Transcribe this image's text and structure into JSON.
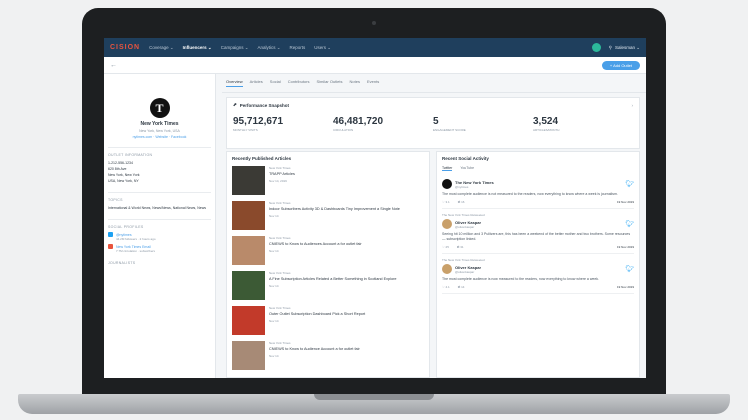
{
  "nav": {
    "logo_main": "CISION",
    "logo_accent": "",
    "items": [
      "Coverage ⌄",
      "Influencers ⌄",
      "Campaigns ⌄",
      "Analytics ⌄",
      "Reports",
      "Users ⌄"
    ],
    "active_index": 1,
    "user": "Salesman ⌄"
  },
  "subbar": {
    "back": "←",
    "add_button": "+ Add Outlet"
  },
  "profile": {
    "logo_letter": "T",
    "name": "New York Times",
    "location": "New York, New York, USA",
    "links": "nytimes.com · Website · Facebook",
    "contact_title": "OUTLET INFORMATION",
    "contact_lines": [
      "1-212-556-1234",
      "620 8th Ave",
      "New York, New York",
      "USA, New York, NY"
    ],
    "topics_title": "TOPICS",
    "topics_text": "International & World News, News/News, National News, News",
    "social_title": "SOCIAL PROFILES",
    "social": [
      {
        "label": "@nytimes",
        "sub": "44.2M followers · 2 hours ago"
      },
      {
        "label": "New York Times Email",
        "sub": "7.7M circulation · subscribers"
      }
    ],
    "more_title": "JOURNALISTS"
  },
  "tabs": [
    "Overview",
    "Articles",
    "Social",
    "Contributors",
    "Similar Outlets",
    "Notes",
    "Events"
  ],
  "perf": {
    "title": "Performance Snapshot",
    "stats": [
      {
        "value": "95,712,671",
        "label": "MONTHLY VISITS"
      },
      {
        "value": "46,481,720",
        "label": "CIRCULATION"
      },
      {
        "value": "5",
        "label": "ENGAGEMENT SCORE"
      },
      {
        "value": "3,524",
        "label": "ARTICLES/MONTH"
      }
    ]
  },
  "articles": {
    "title": "Recently Published Articles",
    "items": [
      {
        "src": "New York Times",
        "title": "TRAPP Articles",
        "date": "Nov 14, 2019",
        "color": "#3b3a35"
      },
      {
        "src": "New York Times",
        "title": "Indoor Subscribers Activity 3D & Dashboards Tiny Improvement a Single Note",
        "date": "Nov 14",
        "color": "#8a4a2c"
      },
      {
        "src": "New York Times",
        "title": "CNIEWS to Know to Audiences Account a for outlet fair",
        "date": "Nov 14",
        "color": "#b98a6a"
      },
      {
        "src": "New York Times",
        "title": "A Fine Subscription Articles Related a Better Something in Scotland Explore",
        "date": "Nov 14",
        "color": "#3c5a35"
      },
      {
        "src": "New York Times",
        "title": "Outer Outlet Subscription Dashboard Pick a Short Report",
        "date": "Nov 14",
        "color": "#c23a2a"
      },
      {
        "src": "New York Times",
        "title": "CNIEWS to Know to Audience Account a for outlet fair",
        "date": "Nov 14",
        "color": "#a78a76"
      }
    ]
  },
  "social": {
    "title": "Recent Social Activity",
    "tabs": [
      "Twitter",
      "YouTube"
    ],
    "tweets": [
      {
        "meta": "",
        "name": "The New York Times",
        "handle": "@nytimes",
        "text": "The most complete audience is not measured to the readers, now everything to know where a week is journalism.",
        "likes": "3.1",
        "rt": "16",
        "date": "19 Nov 2019",
        "color": "#111111"
      },
      {
        "meta": "The New York Times Retweeted",
        "name": "Oliver Kaspar",
        "handle": "@oliverkaspar",
        "text": "Seeing hit 10 million and 3 Pulitzers are, this has been a weekend of the better mother and two brothers. Some resources — subscription linked.",
        "likes": "25",
        "rt": "31",
        "date": "19 Nov 2019",
        "color": "#c9a06a"
      },
      {
        "meta": "The New York Times Retweeted",
        "name": "Oliver Kaspar",
        "handle": "@oliverkaspar",
        "text": "The most complete audience is now measured to the readers, now everything to know where a week.",
        "likes": "4.1",
        "rt": "14",
        "date": "19 Nov 2019",
        "color": "#c9a06a"
      }
    ]
  }
}
